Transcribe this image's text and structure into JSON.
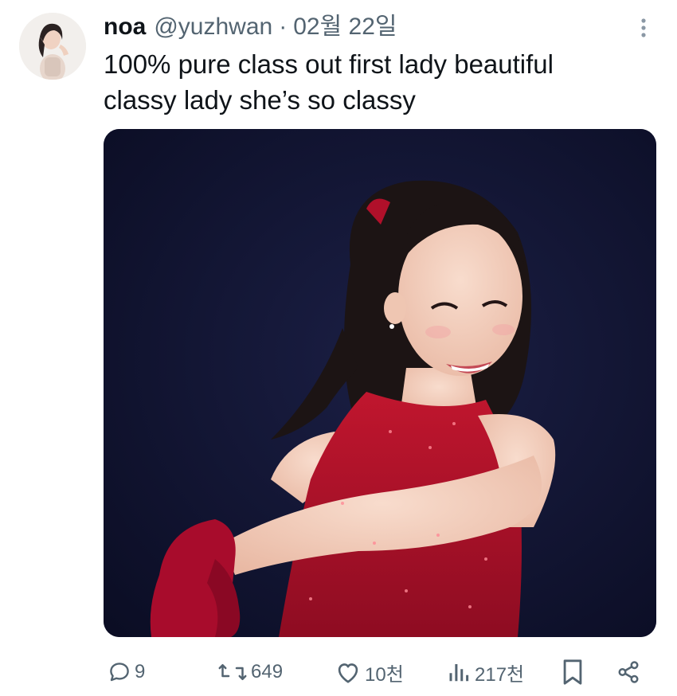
{
  "tweet": {
    "display_name": "noa",
    "handle": "@yuzhwan",
    "separator": "·",
    "date": "02월 22일",
    "text": "100% pure class out first lady beautiful\nclassy lady she’s so classy",
    "media_alt": "Figure skater in a red sequined dress and red gloves smiling"
  },
  "actions": {
    "reply_count": "9",
    "retweet_count": "649",
    "like_count": "10천",
    "view_count": "217천"
  },
  "icons": {
    "more": "more-vertical-icon",
    "reply": "reply-icon",
    "retweet": "retweet-icon",
    "like": "heart-icon",
    "views": "analytics-icon",
    "bookmark": "bookmark-icon",
    "share": "share-icon"
  },
  "colors": {
    "text": "#0f1419",
    "secondary": "#536471",
    "dress_red": "#b0102a",
    "background_navy": "#10122d"
  }
}
